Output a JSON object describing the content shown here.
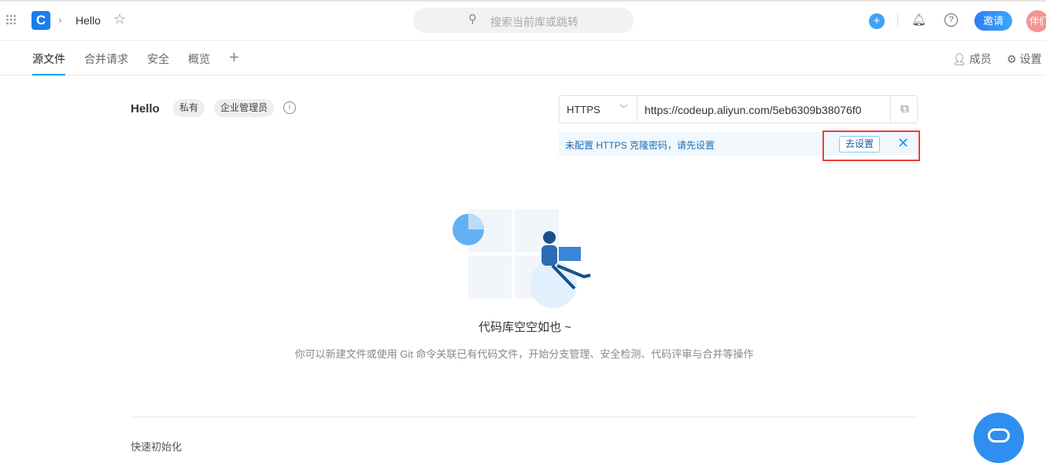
{
  "header": {
    "repo_name": "Hello",
    "search_placeholder": "搜索当前库或跳转",
    "invite_label": "邀请",
    "avatar_text": "伴们"
  },
  "tabs": [
    {
      "label": "源文件"
    },
    {
      "label": "合并请求"
    },
    {
      "label": "安全"
    },
    {
      "label": "概览"
    }
  ],
  "right_actions": {
    "members": "成员",
    "settings": "设置"
  },
  "repo": {
    "title": "Hello",
    "tags": [
      "私有",
      "企业管理员"
    ]
  },
  "clone": {
    "protocol": "HTTPS",
    "url": "https://codeup.aliyun.com/5eb6309b38076f0",
    "notice": "未配置 HTTPS 克隆密码，请先设置",
    "notice_button": "去设置"
  },
  "empty": {
    "title": "代码库空空如也 ~",
    "description": "你可以新建文件或使用 Git 命令关联已有代码文件，开始分支管理、安全检测、代码评审与合并等操作"
  },
  "quick_init": "快速初始化",
  "colors": {
    "accent": "#1b9aee",
    "highlight": "#f03c3c"
  }
}
